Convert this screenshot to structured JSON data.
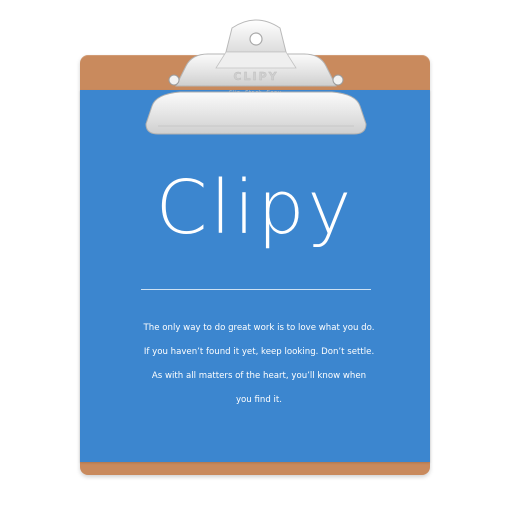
{
  "app": {
    "name": "Clipy",
    "clip_engraving": "CLIPY",
    "clip_subtext": "Clip. Stack. Copy."
  },
  "quote": {
    "lines": [
      "The only way to do great work is to love what you do.",
      "If you haven’t found it yet, keep looking. Don’t settle.",
      "As with all matters of the heart, you’ll know when",
      "you find it."
    ]
  },
  "colors": {
    "paper": "#3c86cf",
    "board": "#c98a5d",
    "clip": "#e6e6e6",
    "text": "#ffffff"
  },
  "icons": {
    "clip": "clipboard-clip-icon"
  }
}
